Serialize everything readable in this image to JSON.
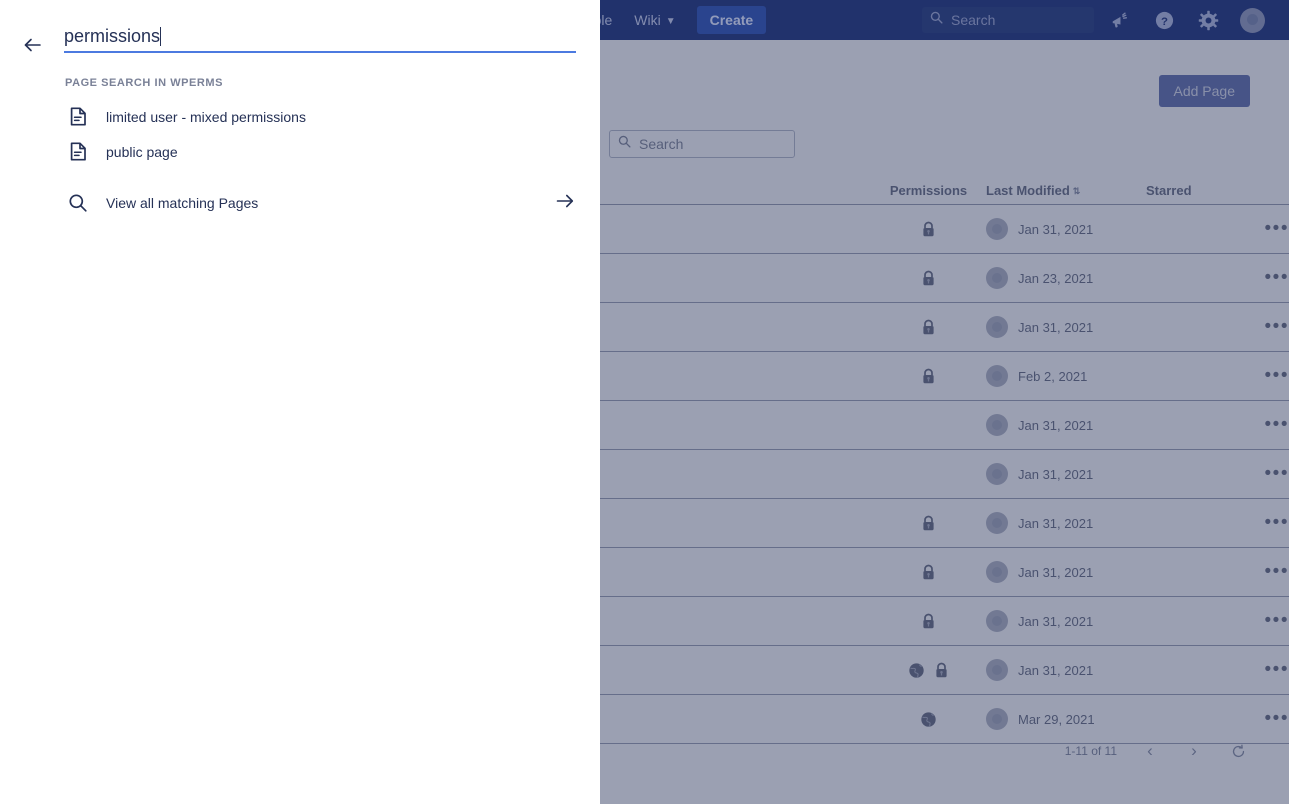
{
  "navbar": {
    "console_label": "onsole",
    "wiki_label": "Wiki",
    "wiki_chevron": "chevron-down-icon",
    "create_label": "Create",
    "search_placeholder": "Search",
    "icons": {
      "announcement": "megaphone-icon",
      "help": "help-icon",
      "settings": "gear-icon",
      "profile": "avatar-icon"
    }
  },
  "page": {
    "add_page_label": "Add Page",
    "search_placeholder": "Search"
  },
  "table": {
    "headers": {
      "title": "",
      "permissions": "Permissions",
      "last_modified": "Last Modified",
      "sort_indicator": "⇅",
      "starred": "Starred"
    },
    "rows": [
      {
        "permissions": [
          "lock"
        ],
        "date": "Jan 31, 2021",
        "actions": "•••"
      },
      {
        "permissions": [
          "lock"
        ],
        "date": "Jan 23, 2021",
        "actions": "•••"
      },
      {
        "permissions": [
          "lock"
        ],
        "date": "Jan 31, 2021",
        "actions": "•••"
      },
      {
        "permissions": [
          "lock"
        ],
        "date": "Feb 2, 2021",
        "actions": "•••"
      },
      {
        "permissions": [],
        "date": "Jan 31, 2021",
        "actions": "•••"
      },
      {
        "permissions": [],
        "date": "Jan 31, 2021",
        "actions": "•••"
      },
      {
        "permissions": [
          "lock"
        ],
        "date": "Jan 31, 2021",
        "actions": "•••"
      },
      {
        "permissions": [
          "lock"
        ],
        "date": "Jan 31, 2021",
        "actions": "•••"
      },
      {
        "permissions": [
          "lock"
        ],
        "date": "Jan 31, 2021",
        "actions": "•••"
      },
      {
        "permissions": [
          "globe",
          "lock"
        ],
        "date": "Jan 31, 2021",
        "actions": "•••"
      },
      {
        "permissions": [
          "globe"
        ],
        "date": "Mar 29, 2021",
        "actions": "•••"
      }
    ]
  },
  "pagination": {
    "count_label": "1-11 of 11",
    "prev": "‹",
    "next": "›",
    "refresh": "refresh-icon"
  },
  "search_drawer": {
    "back": "back-arrow-icon",
    "query": "permissions",
    "section_label": "PAGE SEARCH IN WPERMS",
    "results": [
      {
        "icon": "page-icon",
        "label": "limited user - mixed permissions"
      },
      {
        "icon": "page-icon",
        "label": "public page"
      }
    ],
    "view_all_label": "View all matching Pages",
    "view_all_icon": "search-icon",
    "view_all_arrow": "arrow-right-icon"
  },
  "colors": {
    "navbar": "#1c2f6b",
    "create_button": "#2b4fa6",
    "add_page_button": "#24378f",
    "accent_underline": "#4c7ae0",
    "text_dark": "#253156",
    "label_gray": "#7a8197",
    "scrim": "#5d6582"
  }
}
